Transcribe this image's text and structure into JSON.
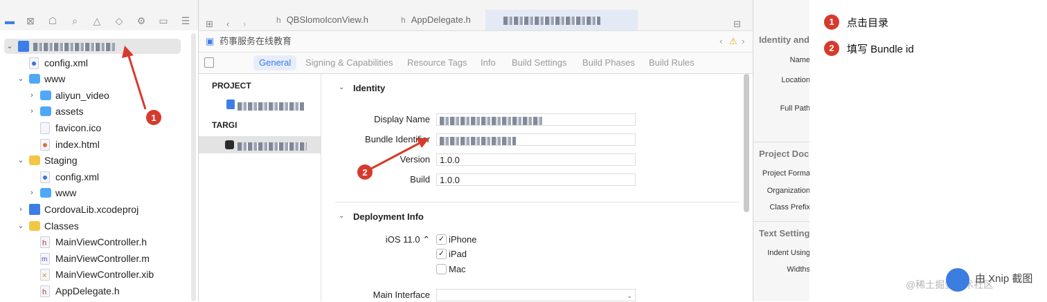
{
  "navigator": {
    "items": [
      {
        "label": "",
        "kind": "proj",
        "level": 0,
        "disclosure": "open",
        "blurred": true
      },
      {
        "label": "config.xml",
        "kind": "xml",
        "level": 1
      },
      {
        "label": "www",
        "kind": "folder",
        "level": 1,
        "disclosure": "open"
      },
      {
        "label": "aliyun_video",
        "kind": "folder",
        "level": 2,
        "disclosure": "closed"
      },
      {
        "label": "assets",
        "kind": "folder",
        "level": 2,
        "disclosure": "closed"
      },
      {
        "label": "favicon.ico",
        "kind": "file",
        "level": 2
      },
      {
        "label": "index.html",
        "kind": "html",
        "level": 2
      },
      {
        "label": "Staging",
        "kind": "folder-y",
        "level": 1,
        "disclosure": "open"
      },
      {
        "label": "config.xml",
        "kind": "xml",
        "level": 2
      },
      {
        "label": "www",
        "kind": "folder",
        "level": 2,
        "disclosure": "closed"
      },
      {
        "label": "CordovaLib.xcodeproj",
        "kind": "proj",
        "level": 1,
        "disclosure": "closed"
      },
      {
        "label": "Classes",
        "kind": "folder-y",
        "level": 1,
        "disclosure": "open"
      },
      {
        "label": "MainViewController.h",
        "kind": "hfile",
        "level": 2
      },
      {
        "label": "MainViewController.m",
        "kind": "mfile",
        "level": 2
      },
      {
        "label": "MainViewController.xib",
        "kind": "xib",
        "level": 2
      },
      {
        "label": "AppDelegate.h",
        "kind": "hfile",
        "level": 2
      }
    ]
  },
  "tabs": [
    {
      "label": "QBSlomoIconView.h"
    },
    {
      "label": "AppDelegate.h"
    },
    {
      "label": ""
    }
  ],
  "jumpbar": {
    "breadcrumb": "药事服务在线教育"
  },
  "settings_tabs": [
    "General",
    "Signing & Capabilities",
    "Resource Tags",
    "Info",
    "Build Settings",
    "Build Phases",
    "Build Rules"
  ],
  "targets": {
    "project_header": "PROJECT",
    "targets_header": "TARGI"
  },
  "identity": {
    "section_title": "Identity",
    "display_name_label": "Display Name",
    "bundle_id_label": "Bundle Identifier",
    "version_label": "Version",
    "version_value": "1.0.0",
    "build_label": "Build",
    "build_value": "1.0.0"
  },
  "deployment": {
    "section_title": "Deployment Info",
    "ios_version": "iOS 11.0 ⌃",
    "devices": [
      {
        "label": "iPhone",
        "checked": true
      },
      {
        "label": "iPad",
        "checked": true
      },
      {
        "label": "Mac",
        "checked": false
      }
    ],
    "main_interface_label": "Main Interface"
  },
  "inspector": {
    "identity_header": "Identity and",
    "name_label": "Name",
    "location_label": "Location",
    "fullpath_label": "Full Path",
    "project_doc_header": "Project Doc",
    "project_format_label": "Project Forma",
    "organization_label": "Organization",
    "class_prefix_label": "Class Prefix",
    "text_settings_header": "Text Setting",
    "indent_label": "Indent Using",
    "widths_label": "Widths"
  },
  "annotations": {
    "steps": [
      {
        "number": "1",
        "text": "点击目录"
      },
      {
        "number": "2",
        "text": "填写 Bundle id"
      }
    ],
    "watermark": "由 Xnip 截图",
    "watermark_under": "@稀土掘金技术社区"
  },
  "colors": {
    "accent": "#3478f6",
    "annotation_red": "#d63a2c",
    "selection": "#e6e6e6"
  }
}
